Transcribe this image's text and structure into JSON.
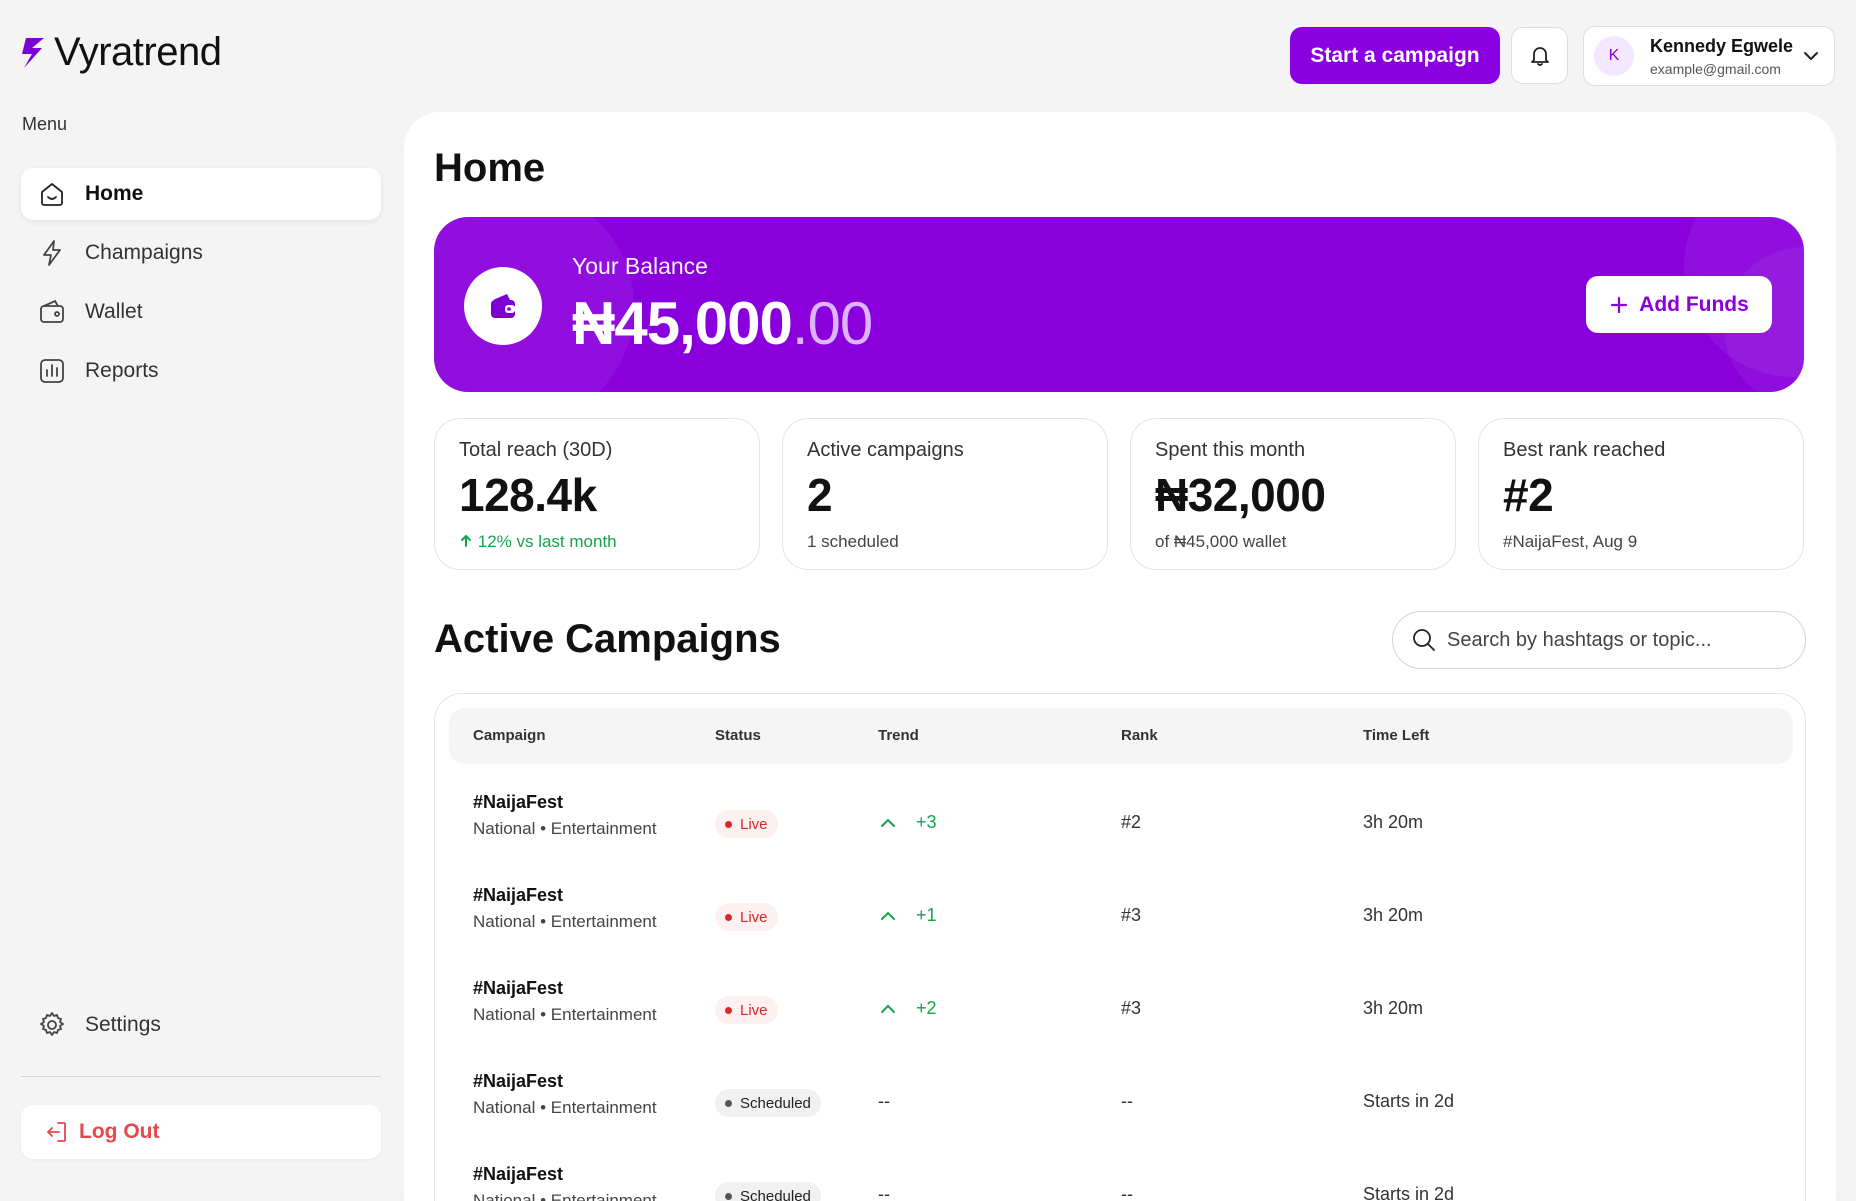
{
  "app": {
    "name": "Vyratrend"
  },
  "sidebar": {
    "menu_label": "Menu",
    "items": [
      {
        "label": "Home",
        "icon": "home-icon",
        "active": true
      },
      {
        "label": "Champaigns",
        "icon": "bolt-icon",
        "active": false
      },
      {
        "label": "Wallet",
        "icon": "wallet-icon",
        "active": false
      },
      {
        "label": "Reports",
        "icon": "chart-icon",
        "active": false
      }
    ],
    "settings_label": "Settings",
    "logout_label": "Log Out"
  },
  "header": {
    "start_campaign_label": "Start a campaign",
    "user": {
      "initial": "K",
      "name": "Kennedy Egwele",
      "email": "example@gmail.com"
    }
  },
  "page": {
    "title": "Home"
  },
  "balance": {
    "label": "Your Balance",
    "amount_main": "₦45,000",
    "amount_decimal": ".00",
    "add_funds_label": "Add Funds"
  },
  "stats": [
    {
      "label": "Total reach (30D)",
      "value": "128.4k",
      "sub": "12% vs last month",
      "trend_up": true
    },
    {
      "label": "Active campaigns",
      "value": "2",
      "sub": "1 scheduled"
    },
    {
      "label": "Spent this month",
      "value": "₦32,000",
      "sub": "of ₦45,000 wallet"
    },
    {
      "label": "Best rank reached",
      "value": "#2",
      "sub": "#NaijaFest, Aug 9"
    }
  ],
  "campaigns": {
    "title": "Active Campaigns",
    "search_placeholder": "Search by hashtags or topic...",
    "columns": [
      "Campaign",
      "Status",
      "Trend",
      "Rank",
      "Time Left"
    ],
    "rows": [
      {
        "name": "#NaijaFest",
        "sub": "National • Entertainment",
        "status": "Live",
        "trend": "+3",
        "rank": "#2",
        "time": "3h 20m"
      },
      {
        "name": "#NaijaFest",
        "sub": "National • Entertainment",
        "status": "Live",
        "trend": "+1",
        "rank": "#3",
        "time": "3h 20m"
      },
      {
        "name": "#NaijaFest",
        "sub": "National • Entertainment",
        "status": "Live",
        "trend": "+2",
        "rank": "#3",
        "time": "3h 20m"
      },
      {
        "name": "#NaijaFest",
        "sub": "National • Entertainment",
        "status": "Scheduled",
        "trend": "--",
        "rank": "--",
        "time": "Starts in 2d"
      },
      {
        "name": "#NaijaFest",
        "sub": "National • Entertainment",
        "status": "Scheduled",
        "trend": "--",
        "rank": "--",
        "time": "Starts in 2d"
      }
    ]
  },
  "colors": {
    "brand": "#8a00dc",
    "positive": "#16a34a",
    "live": "#dc2626",
    "logout": "#e5484d"
  }
}
